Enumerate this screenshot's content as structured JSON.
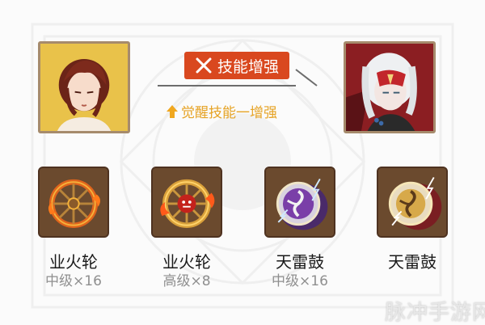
{
  "skill_banner": {
    "label": "技能增强",
    "icon": "crossed-swords-icon"
  },
  "awaken": {
    "label": "觉醒技能一增强",
    "icon": "arrow-up-icon"
  },
  "portraits": {
    "left": {
      "icon": "red-haired-character-portrait"
    },
    "right": {
      "icon": "white-haired-masked-character-portrait"
    }
  },
  "items": [
    {
      "name": "业火轮",
      "grade": "中级×16",
      "icon": "fire-wheel-icon"
    },
    {
      "name": "业火轮",
      "grade": "高级×8",
      "icon": "fire-wheel-demon-icon"
    },
    {
      "name": "天雷鼓",
      "grade": "中级×16",
      "icon": "thunder-drum-purple-icon"
    },
    {
      "name": "天雷鼓",
      "grade": "",
      "icon": "thunder-drum-gold-icon"
    }
  ],
  "watermark": {
    "text": "脉冲手游网"
  },
  "colors": {
    "banner": "#d9481f",
    "awaken": "#e6a325",
    "frame": "#a68b6c",
    "item_bg": "#6b4a2e"
  }
}
